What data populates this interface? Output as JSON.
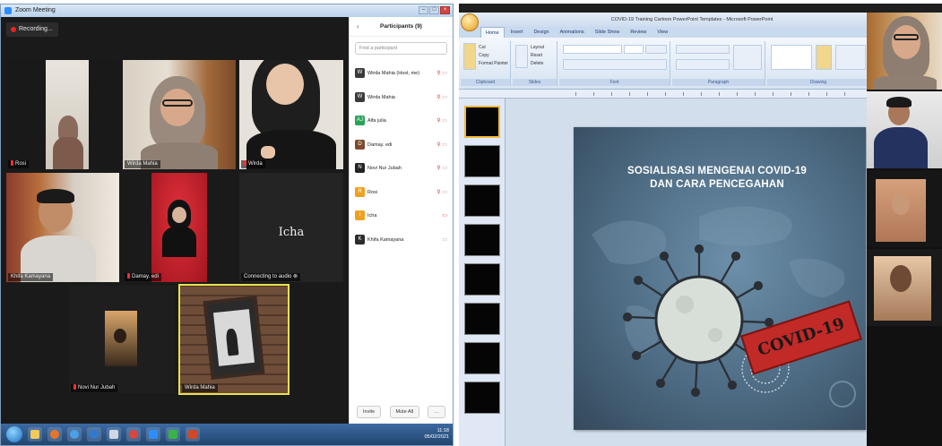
{
  "zoom": {
    "window_title": "Zoom Meeting",
    "recording_label": "Recording...",
    "tiles": [
      {
        "name": "Rosi",
        "muted": true
      },
      {
        "name": "Wirda Mahia",
        "muted": false
      },
      {
        "name": "Wirda",
        "muted": true
      },
      {
        "name": "Khifa Kamayana",
        "muted": false
      },
      {
        "name": "Damay. edi",
        "muted": true
      },
      {
        "name": "Connecting to audio",
        "muted": false,
        "display_name": "Icha"
      },
      {
        "name": "Novi Nur Jubah",
        "muted": true
      },
      {
        "name": "Wirda Mahia",
        "muted": false
      }
    ],
    "participants": {
      "title": "Participants (9)",
      "search_placeholder": "Find a participant",
      "list": [
        {
          "name": "Wirda Mahia (Host, me)",
          "initial": "W",
          "color": "#3a3a3a",
          "icons": "§ □"
        },
        {
          "name": "Wirda Mahia",
          "initial": "W",
          "color": "#3a3a3a",
          "icons": "§ □"
        },
        {
          "name": "Alfa julia",
          "initial": "AJ",
          "color": "#29a35a",
          "icons": "§ □"
        },
        {
          "name": "Damay. edi",
          "initial": "D",
          "color": "#7d4b2f",
          "icons": "§ □"
        },
        {
          "name": "Novi Nur Jubah",
          "initial": "N",
          "color": "#222222",
          "icons": "§ □"
        },
        {
          "name": "Rosi",
          "initial": "R",
          "color": "#f0a020",
          "icons": "§ □"
        },
        {
          "name": "Icha",
          "initial": "I",
          "color": "#f0a020",
          "icons": "□"
        },
        {
          "name": "Khifa Kamayana",
          "initial": "K",
          "color": "#2c2c2c",
          "icons": "□"
        }
      ],
      "invite_label": "Invite",
      "mute_all_label": "Mute All"
    },
    "tray_time": "11:18",
    "tray_date": "05/02/2021"
  },
  "powerpoint": {
    "window_title": "COVID-19 Training Cartoon PowerPoint Templates - Microsoft PowerPoint",
    "tabs": [
      "Home",
      "Insert",
      "Design",
      "Animations",
      "Slide Show",
      "Review",
      "View"
    ],
    "ribbon_groups": [
      "Clipboard",
      "Slides",
      "Font",
      "Paragraph",
      "Drawing"
    ],
    "clipboard_buttons": [
      "Cut",
      "Copy",
      "Format Painter"
    ],
    "slides_buttons": [
      "Layout",
      "Reset",
      "Delete"
    ],
    "slide": {
      "title_line1": "SOSIALISASI MENGENAI COVID-19",
      "title_line2": "DAN CARA PENCEGAHAN",
      "stamp_text": "COVID-19"
    },
    "colors": {
      "stamp_red": "#c22a27",
      "slide_bg": "#4d6b83",
      "selected_thumb_border": "#f2b93b"
    }
  }
}
